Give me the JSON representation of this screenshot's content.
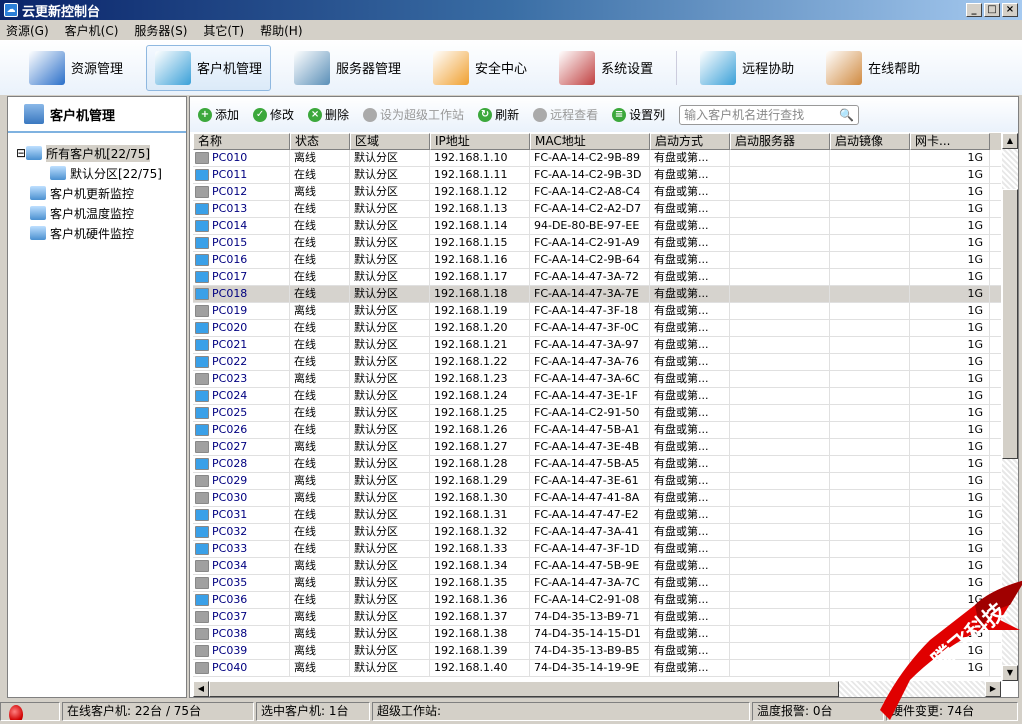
{
  "window": {
    "title": "云更新控制台",
    "buttons": [
      "_",
      "□",
      "×"
    ]
  },
  "menu": [
    "资源(G)",
    "客户机(C)",
    "服务器(S)",
    "其它(T)",
    "帮助(H)"
  ],
  "toolbar": [
    {
      "label": "资源管理",
      "icon": "folder-icon",
      "color": "#2a6fc9"
    },
    {
      "label": "客户机管理",
      "icon": "monitor-icon",
      "color": "#3aa0d8",
      "active": true
    },
    {
      "label": "服务器管理",
      "icon": "server-icon",
      "color": "#5a8fb8"
    },
    {
      "label": "安全中心",
      "icon": "shield-icon",
      "color": "#f0a030"
    },
    {
      "label": "系统设置",
      "icon": "tools-icon",
      "color": "#c04040"
    },
    {
      "label": "远程协助",
      "icon": "remote-monitor-icon",
      "color": "#3aa0d8"
    },
    {
      "label": "在线帮助",
      "icon": "support-person-icon",
      "color": "#d08a40"
    }
  ],
  "left": {
    "title": "客户机管理",
    "tree": [
      {
        "label": "所有客户机[22/75]",
        "icon": "computer-group-icon",
        "level": 0,
        "selected": true,
        "expander": "⊟"
      },
      {
        "label": "默认分区[22/75]",
        "icon": "monitor-icon",
        "level": 1
      },
      {
        "label": "客户机更新监控",
        "icon": "update-monitor-icon",
        "level": 0
      },
      {
        "label": "客户机温度监控",
        "icon": "temperature-icon",
        "level": 0
      },
      {
        "label": "客户机硬件监控",
        "icon": "hardware-icon",
        "level": 0
      }
    ]
  },
  "actions": [
    {
      "label": "添加",
      "icon": "add-icon",
      "color": "#3ca83c"
    },
    {
      "label": "修改",
      "icon": "check-icon",
      "color": "#3ca83c"
    },
    {
      "label": "删除",
      "icon": "delete-icon",
      "color": "#3ca83c"
    },
    {
      "label": "设为超级工作站",
      "icon": "user-icon",
      "disabled": true
    },
    {
      "label": "刷新",
      "icon": "refresh-icon",
      "color": "#3ca83c"
    },
    {
      "label": "远程查看",
      "icon": "remote-view-icon",
      "disabled": true
    },
    {
      "label": "设置列",
      "icon": "columns-icon",
      "color": "#3ca83c"
    }
  ],
  "search": {
    "placeholder": "输入客户机名进行查找"
  },
  "columns": [
    "名称",
    "状态",
    "区域",
    "IP地址",
    "MAC地址",
    "启动方式",
    "启动服务器",
    "启动镜像",
    "网卡..."
  ],
  "rows": [
    [
      "PC010",
      "离线",
      "默认分区",
      "192.168.1.10",
      "FC-AA-14-C2-9B-89",
      "有盘或第...",
      "",
      "",
      "1G"
    ],
    [
      "PC011",
      "在线",
      "默认分区",
      "192.168.1.11",
      "FC-AA-14-C2-9B-3D",
      "有盘或第...",
      "",
      "",
      "1G"
    ],
    [
      "PC012",
      "离线",
      "默认分区",
      "192.168.1.12",
      "FC-AA-14-C2-A8-C4",
      "有盘或第...",
      "",
      "",
      "1G"
    ],
    [
      "PC013",
      "在线",
      "默认分区",
      "192.168.1.13",
      "FC-AA-14-C2-A2-D7",
      "有盘或第...",
      "",
      "",
      "1G"
    ],
    [
      "PC014",
      "在线",
      "默认分区",
      "192.168.1.14",
      "94-DE-80-BE-97-EE",
      "有盘或第...",
      "",
      "",
      "1G"
    ],
    [
      "PC015",
      "在线",
      "默认分区",
      "192.168.1.15",
      "FC-AA-14-C2-91-A9",
      "有盘或第...",
      "",
      "",
      "1G"
    ],
    [
      "PC016",
      "在线",
      "默认分区",
      "192.168.1.16",
      "FC-AA-14-C2-9B-64",
      "有盘或第...",
      "",
      "",
      "1G"
    ],
    [
      "PC017",
      "在线",
      "默认分区",
      "192.168.1.17",
      "FC-AA-14-47-3A-72",
      "有盘或第...",
      "",
      "",
      "1G"
    ],
    [
      "PC018",
      "在线",
      "默认分区",
      "192.168.1.18",
      "FC-AA-14-47-3A-7E",
      "有盘或第...",
      "",
      "",
      "1G"
    ],
    [
      "PC019",
      "离线",
      "默认分区",
      "192.168.1.19",
      "FC-AA-14-47-3F-18",
      "有盘或第...",
      "",
      "",
      "1G"
    ],
    [
      "PC020",
      "在线",
      "默认分区",
      "192.168.1.20",
      "FC-AA-14-47-3F-0C",
      "有盘或第...",
      "",
      "",
      "1G"
    ],
    [
      "PC021",
      "在线",
      "默认分区",
      "192.168.1.21",
      "FC-AA-14-47-3A-97",
      "有盘或第...",
      "",
      "",
      "1G"
    ],
    [
      "PC022",
      "在线",
      "默认分区",
      "192.168.1.22",
      "FC-AA-14-47-3A-76",
      "有盘或第...",
      "",
      "",
      "1G"
    ],
    [
      "PC023",
      "离线",
      "默认分区",
      "192.168.1.23",
      "FC-AA-14-47-3A-6C",
      "有盘或第...",
      "",
      "",
      "1G"
    ],
    [
      "PC024",
      "在线",
      "默认分区",
      "192.168.1.24",
      "FC-AA-14-47-3E-1F",
      "有盘或第...",
      "",
      "",
      "1G"
    ],
    [
      "PC025",
      "在线",
      "默认分区",
      "192.168.1.25",
      "FC-AA-14-C2-91-50",
      "有盘或第...",
      "",
      "",
      "1G"
    ],
    [
      "PC026",
      "在线",
      "默认分区",
      "192.168.1.26",
      "FC-AA-14-47-5B-A1",
      "有盘或第...",
      "",
      "",
      "1G"
    ],
    [
      "PC027",
      "离线",
      "默认分区",
      "192.168.1.27",
      "FC-AA-14-47-3E-4B",
      "有盘或第...",
      "",
      "",
      "1G"
    ],
    [
      "PC028",
      "在线",
      "默认分区",
      "192.168.1.28",
      "FC-AA-14-47-5B-A5",
      "有盘或第...",
      "",
      "",
      "1G"
    ],
    [
      "PC029",
      "离线",
      "默认分区",
      "192.168.1.29",
      "FC-AA-14-47-3E-61",
      "有盘或第...",
      "",
      "",
      "1G"
    ],
    [
      "PC030",
      "离线",
      "默认分区",
      "192.168.1.30",
      "FC-AA-14-47-41-8A",
      "有盘或第...",
      "",
      "",
      "1G"
    ],
    [
      "PC031",
      "在线",
      "默认分区",
      "192.168.1.31",
      "FC-AA-14-47-47-E2",
      "有盘或第...",
      "",
      "",
      "1G"
    ],
    [
      "PC032",
      "在线",
      "默认分区",
      "192.168.1.32",
      "FC-AA-14-47-3A-41",
      "有盘或第...",
      "",
      "",
      "1G"
    ],
    [
      "PC033",
      "在线",
      "默认分区",
      "192.168.1.33",
      "FC-AA-14-47-3F-1D",
      "有盘或第...",
      "",
      "",
      "1G"
    ],
    [
      "PC034",
      "离线",
      "默认分区",
      "192.168.1.34",
      "FC-AA-14-47-5B-9E",
      "有盘或第...",
      "",
      "",
      "1G"
    ],
    [
      "PC035",
      "离线",
      "默认分区",
      "192.168.1.35",
      "FC-AA-14-47-3A-7C",
      "有盘或第...",
      "",
      "",
      "1G"
    ],
    [
      "PC036",
      "在线",
      "默认分区",
      "192.168.1.36",
      "FC-AA-14-C2-91-08",
      "有盘或第...",
      "",
      "",
      "1G"
    ],
    [
      "PC037",
      "离线",
      "默认分区",
      "192.168.1.37",
      "74-D4-35-13-B9-71",
      "有盘或第...",
      "",
      "",
      "1G"
    ],
    [
      "PC038",
      "离线",
      "默认分区",
      "192.168.1.38",
      "74-D4-35-14-15-D1",
      "有盘或第...",
      "",
      "",
      "1G"
    ],
    [
      "PC039",
      "离线",
      "默认分区",
      "192.168.1.39",
      "74-D4-35-13-B9-B5",
      "有盘或第...",
      "",
      "",
      "1G"
    ],
    [
      "PC040",
      "离线",
      "默认分区",
      "192.168.1.40",
      "74-D4-35-14-19-9E",
      "有盘或第...",
      "",
      "",
      "1G"
    ]
  ],
  "selected_row": "PC018",
  "status": {
    "online": "在线客户机: 22台 / 75台",
    "selected": "选中客户机: 1台",
    "super": "超级工作站:",
    "temp": "温度报警: 0台",
    "hardware": "硬件变更: 74台"
  },
  "watermark": "腾飞科技",
  "colors": {
    "online_icon": "#3aa0e8",
    "offline_icon": "#a0a0a0",
    "selected_row": "#d6d3ce",
    "ribbon": "#e00000"
  }
}
